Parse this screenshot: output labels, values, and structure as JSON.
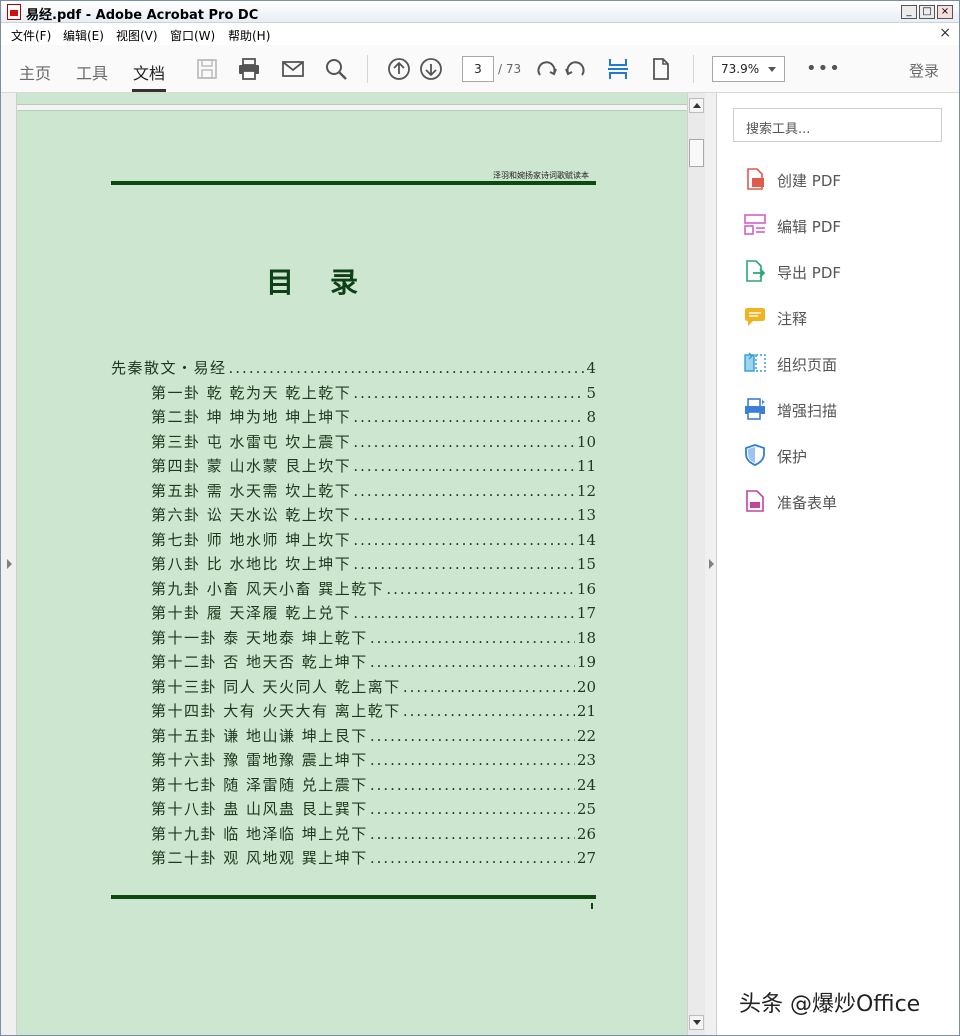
{
  "window": {
    "title": "易经.pdf - Adobe Acrobat Pro DC",
    "minimize": "_",
    "maximize": "□",
    "close": "×"
  },
  "menu": {
    "items": [
      "文件(F)",
      "编辑(E)",
      "视图(V)",
      "窗口(W)",
      "帮助(H)"
    ],
    "close": "×"
  },
  "toolbar": {
    "tabs": [
      "主页",
      "工具",
      "文档"
    ],
    "active_tab": "文档",
    "page_current": "3",
    "page_total": "/ 73",
    "zoom": "73.9%",
    "more": "•••",
    "login": "登录",
    "icons": [
      "save-icon",
      "print-icon",
      "mail-icon",
      "search-icon",
      "prev-page-icon",
      "next-page-icon",
      "rotate-cw-icon",
      "rotate-ccw-icon",
      "fit-width-icon",
      "page-icon"
    ]
  },
  "document": {
    "header": "泽羽和婉扬家诗词歌赋读本",
    "title": "目录",
    "toc": [
      {
        "label": "先秦散文・易经",
        "page": "4",
        "level": 0
      },
      {
        "label": "第一卦  乾  乾为天  乾上乾下",
        "page": "5",
        "level": 1
      },
      {
        "label": "第二卦  坤  坤为地  坤上坤下",
        "page": "8",
        "level": 1
      },
      {
        "label": "第三卦  屯  水雷屯  坎上震下",
        "page": "10",
        "level": 1
      },
      {
        "label": "第四卦  蒙  山水蒙  艮上坎下",
        "page": "11",
        "level": 1
      },
      {
        "label": "第五卦  需  水天需  坎上乾下",
        "page": "12",
        "level": 1
      },
      {
        "label": "第六卦  讼  天水讼  乾上坎下",
        "page": "13",
        "level": 1
      },
      {
        "label": "第七卦  师  地水师  坤上坎下",
        "page": "14",
        "level": 1
      },
      {
        "label": "第八卦  比  水地比  坎上坤下",
        "page": "15",
        "level": 1
      },
      {
        "label": "第九卦  小畜  风天小畜  巽上乾下",
        "page": "16",
        "level": 1
      },
      {
        "label": "第十卦  履  天泽履  乾上兑下",
        "page": "17",
        "level": 1
      },
      {
        "label": "第十一卦  泰  天地泰  坤上乾下",
        "page": "18",
        "level": 1
      },
      {
        "label": "第十二卦  否  地天否  乾上坤下",
        "page": "19",
        "level": 1
      },
      {
        "label": "第十三卦  同人  天火同人  乾上离下",
        "page": "20",
        "level": 1
      },
      {
        "label": "第十四卦  大有  火天大有  离上乾下",
        "page": "21",
        "level": 1
      },
      {
        "label": "第十五卦  谦  地山谦  坤上艮下",
        "page": "22",
        "level": 1
      },
      {
        "label": "第十六卦  豫  雷地豫  震上坤下",
        "page": "23",
        "level": 1
      },
      {
        "label": "第十七卦  随  泽雷随  兑上震下",
        "page": "24",
        "level": 1
      },
      {
        "label": "第十八卦  蛊  山风蛊  艮上巽下",
        "page": "25",
        "level": 1
      },
      {
        "label": "第十九卦  临  地泽临  坤上兑下",
        "page": "26",
        "level": 1
      },
      {
        "label": "第二十卦  观  风地观  巽上坤下",
        "page": "27",
        "level": 1
      }
    ],
    "page_bg": "#cde6cf",
    "rule_color": "#0c4a12"
  },
  "tools": {
    "search_placeholder": "搜索工具...",
    "items": [
      {
        "label": "创建 PDF",
        "icon": "create-pdf-icon",
        "color": "#e05a4e"
      },
      {
        "label": "编辑 PDF",
        "icon": "edit-pdf-icon",
        "color": "#d35fc4"
      },
      {
        "label": "导出 PDF",
        "icon": "export-pdf-icon",
        "color": "#2aa676"
      },
      {
        "label": "注释",
        "icon": "comment-icon",
        "color": "#f2b322"
      },
      {
        "label": "组织页面",
        "icon": "organize-pages-icon",
        "color": "#2f9ed8"
      },
      {
        "label": "增强扫描",
        "icon": "enhance-scan-icon",
        "color": "#3c7fd6"
      },
      {
        "label": "保护",
        "icon": "protect-icon",
        "color": "#2f7fd6"
      },
      {
        "label": "准备表单",
        "icon": "prepare-form-icon",
        "color": "#c2459a"
      }
    ]
  },
  "watermark": "头条 @爆炒Office"
}
